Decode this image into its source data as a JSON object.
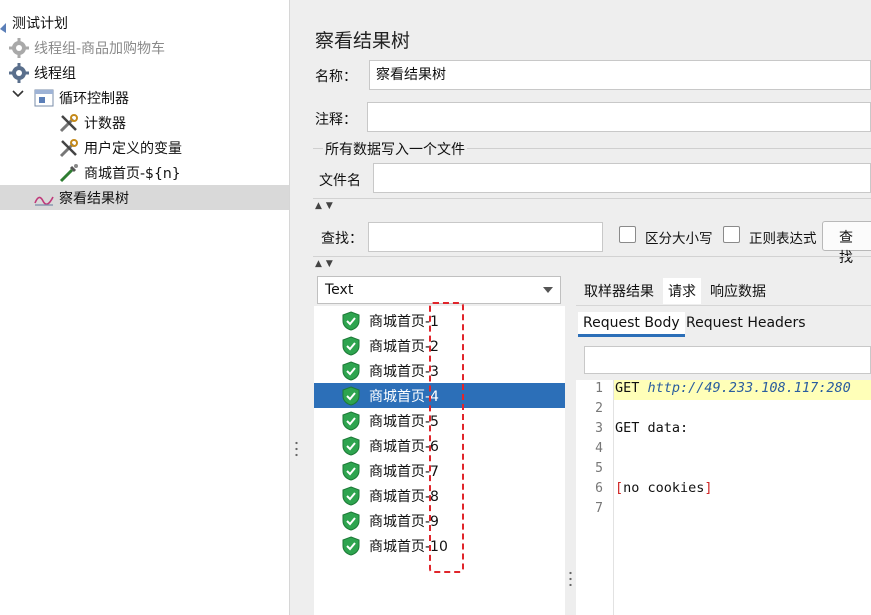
{
  "tree": {
    "items": [
      {
        "label": "测试计划",
        "icon": "test-plan-icon",
        "disabled": false
      },
      {
        "label": "线程组-商品加购物车",
        "icon": "gear-icon",
        "disabled": true
      },
      {
        "label": "线程组",
        "icon": "gear-icon",
        "disabled": false
      },
      {
        "label": "循环控制器",
        "icon": "controller-icon",
        "disabled": false
      },
      {
        "label": "计数器",
        "icon": "config-element-icon",
        "disabled": false
      },
      {
        "label": "用户定义的变量",
        "icon": "config-element-icon",
        "disabled": false
      },
      {
        "label": "商城首页-${n}",
        "icon": "sampler-icon",
        "disabled": false
      },
      {
        "label": "察看结果树",
        "icon": "listener-icon",
        "disabled": false,
        "selected": true
      }
    ]
  },
  "panel": {
    "title": "察看结果树",
    "name_label": "名称：",
    "name_value": "察看结果树",
    "comment_label": "注释：",
    "comment_value": "",
    "group_title": "所有数据写入一个文件",
    "filename_label": "文件名",
    "filename_value": "",
    "search_label": "查找：",
    "search_value": "",
    "case_label": "区分大小写",
    "regex_label": "正则表达式",
    "search_button": "查找"
  },
  "results": {
    "renderer": "Text",
    "items": [
      {
        "label": "商城首页-1",
        "status": "success"
      },
      {
        "label": "商城首页-2",
        "status": "success"
      },
      {
        "label": "商城首页-3",
        "status": "success"
      },
      {
        "label": "商城首页-4",
        "status": "success",
        "selected": true
      },
      {
        "label": "商城首页-5",
        "status": "success"
      },
      {
        "label": "商城首页-6",
        "status": "success"
      },
      {
        "label": "商城首页-7",
        "status": "success"
      },
      {
        "label": "商城首页-8",
        "status": "success"
      },
      {
        "label": "商城首页-9",
        "status": "success"
      },
      {
        "label": "商城首页-10",
        "status": "success"
      }
    ]
  },
  "detail": {
    "tabs": [
      "取样器结果",
      "请求",
      "响应数据"
    ],
    "active_tab": "请求",
    "subtabs": [
      "Request Body",
      "Request Headers"
    ],
    "active_subtab": "Request Body",
    "search_value": "",
    "code": {
      "line_numbers": [
        "1",
        "2",
        "3",
        "4",
        "5",
        "6",
        "7"
      ],
      "line1_method": "GET ",
      "line1_url": "http://49.233.108.117:280",
      "line3": "GET data:",
      "line6_open": "[",
      "line6_text": "no cookies",
      "line6_close": "]"
    }
  },
  "colors": {
    "selection": "#2c6fb8",
    "success": "#2ea44f",
    "annotation": "#e0252b"
  }
}
